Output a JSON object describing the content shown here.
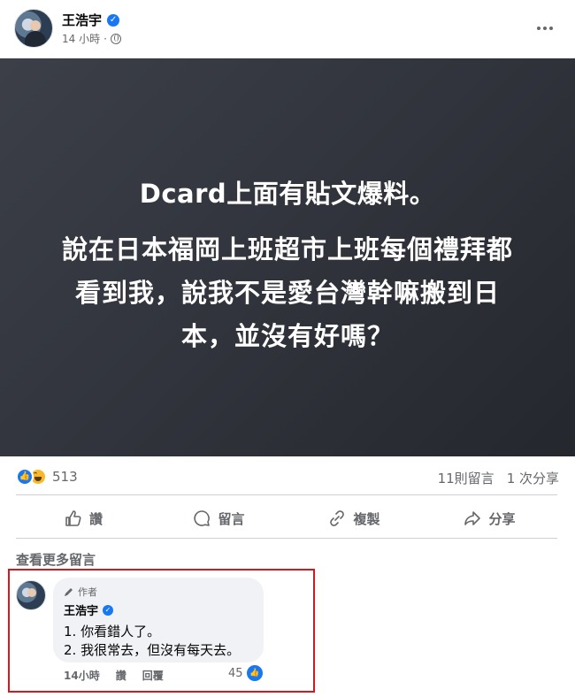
{
  "post": {
    "author": "王浩宇",
    "time": "14 小時",
    "time_sep": "·",
    "headline": "Dcard上面有貼文爆料。",
    "body_lines": [
      "說在日本福岡上班超市上班每個禮拜都",
      "看到我，說我不是愛台灣幹嘛搬到日",
      "本，並沒有好嗎？"
    ]
  },
  "stats": {
    "reactions": "513",
    "comments": "11則留言",
    "shares": "1 次分享"
  },
  "actions": {
    "like": "讚",
    "comment": "留言",
    "copy": "複製",
    "share": "分享"
  },
  "view_more": "查看更多留言",
  "comment": {
    "badge": "作者",
    "name": "王浩宇",
    "lines": [
      "1. 你看錯人了。",
      "2. 我很常去，但沒有每天去。"
    ],
    "time": "14小時",
    "like_label": "讚",
    "reply_label": "回覆",
    "likes": "45"
  },
  "colors": {
    "accent": "#1877f2",
    "highlight": "#d9161c",
    "image_bg": "#32353d"
  },
  "icons": [
    "verified-icon",
    "globe-icon",
    "more-icon",
    "like-icon",
    "haha-icon",
    "comment-icon",
    "copy-icon",
    "share-icon",
    "pen-icon"
  ]
}
